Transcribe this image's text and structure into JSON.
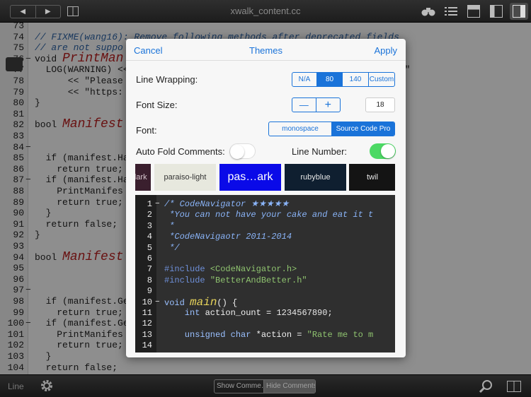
{
  "toolbar": {
    "back": "◀",
    "forward": "▶",
    "file_title": "xwalk_content.cc"
  },
  "editor": {
    "lines": [
      {
        "n": "73",
        "fold": "",
        "text": ""
      },
      {
        "n": "74",
        "fold": "",
        "text": "// FIXME(wang16): Remove following methods after deprecated fields",
        "cls": "cm"
      },
      {
        "n": "75",
        "fold": "",
        "text": "// are not suppo",
        "cls": "cm"
      },
      {
        "n": "76",
        "fold": "−",
        "pre": "void ",
        "fn": "PrintMan",
        "post": "                                          eld) {"
      },
      {
        "n": "77",
        "fold": "",
        "text": "  LOG(WARNING) <<                                                . \""
      },
      {
        "n": "78",
        "fold": "",
        "text": "      << \"Please"
      },
      {
        "n": "79",
        "fold": "",
        "text": "      << \"https:                                               t.\";"
      },
      {
        "n": "80",
        "fold": "",
        "text": "}"
      },
      {
        "n": "81",
        "fold": "",
        "text": ""
      },
      {
        "n": "82",
        "fold": "",
        "pre": "bool ",
        "fn": "Manifest",
        "post": "                                        nifest,"
      },
      {
        "n": "83",
        "fold": "",
        "text": ""
      },
      {
        "n": "84",
        "fold": "−",
        "text": ""
      },
      {
        "n": "85",
        "fold": "",
        "text": "  if (manifest.Ha"
      },
      {
        "n": "86",
        "fold": "",
        "text": "    return true;"
      },
      {
        "n": "87",
        "fold": "−",
        "text": "  if (manifest.Ha"
      },
      {
        "n": "88",
        "fold": "",
        "text": "    PrintManifes"
      },
      {
        "n": "89",
        "fold": "",
        "text": "    return true;"
      },
      {
        "n": "90",
        "fold": "",
        "text": "  }"
      },
      {
        "n": "91",
        "fold": "",
        "text": "  return false;"
      },
      {
        "n": "92",
        "fold": "",
        "text": "}"
      },
      {
        "n": "93",
        "fold": "",
        "text": ""
      },
      {
        "n": "94",
        "fold": "",
        "pre": "bool ",
        "fn": "Manifest",
        "post": "                                         manifest,"
      },
      {
        "n": "95",
        "fold": "",
        "text": ""
      },
      {
        "n": "96",
        "fold": "",
        "text": ""
      },
      {
        "n": "97",
        "fold": "−",
        "text": ""
      },
      {
        "n": "98",
        "fold": "",
        "text": "  if (manifest.Ge"
      },
      {
        "n": "99",
        "fold": "",
        "text": "    return true;"
      },
      {
        "n": "100",
        "fold": "−",
        "text": "  if (manifest.Ge"
      },
      {
        "n": "101",
        "fold": "",
        "text": "    PrintManifes"
      },
      {
        "n": "102",
        "fold": "",
        "text": "    return true;"
      },
      {
        "n": "103",
        "fold": "",
        "text": "  }"
      },
      {
        "n": "104",
        "fold": "",
        "text": "  return false;"
      }
    ]
  },
  "modal": {
    "cancel": "Cancel",
    "title": "Themes",
    "apply": "Apply",
    "line_wrapping": {
      "label": "Line Wrapping:",
      "options": [
        "N/A",
        "80",
        "140",
        "Custom"
      ],
      "selected": "80"
    },
    "font_size": {
      "label": "Font Size:",
      "minus": "—",
      "plus": "+",
      "value": "18"
    },
    "font": {
      "label": "Font:",
      "options": [
        "monospace",
        "Source Code Pro"
      ],
      "selected": "Source Code Pro"
    },
    "auto_fold": {
      "label": "Auto Fold Comments:",
      "on": false
    },
    "line_number": {
      "label": "Line Number:",
      "on": true
    },
    "themes": [
      {
        "name": "o-dark",
        "bg": "#3a1f2e",
        "fg": "#d8c8d0"
      },
      {
        "name": "paraiso-light",
        "bg": "#e7e8de",
        "fg": "#333333"
      },
      {
        "name": "pas…ark",
        "bg": "#0a0ae8",
        "fg": "#ffffff",
        "selected": true
      },
      {
        "name": "rubyblue",
        "bg": "#0f1f30",
        "fg": "#e6e6e6"
      },
      {
        "name": "twil",
        "bg": "#141414",
        "fg": "#e6e6e6"
      }
    ],
    "preview_lines": [
      {
        "n": "1",
        "fold": "−",
        "parts": [
          {
            "c": "p-cm",
            "t": "/* CodeNavigator ★★★★★"
          }
        ]
      },
      {
        "n": "2",
        "fold": "",
        "parts": [
          {
            "c": "p-cm",
            "t": " *You can not have your cake and eat it t"
          }
        ]
      },
      {
        "n": "3",
        "fold": "",
        "parts": [
          {
            "c": "p-cm",
            "t": " *"
          }
        ]
      },
      {
        "n": "4",
        "fold": "",
        "parts": [
          {
            "c": "p-cm",
            "t": " *CodeNavigaotr 2011-2014"
          }
        ]
      },
      {
        "n": "5",
        "fold": "",
        "parts": [
          {
            "c": "p-cm",
            "t": " */"
          }
        ]
      },
      {
        "n": "6",
        "fold": "",
        "parts": []
      },
      {
        "n": "7",
        "fold": "",
        "parts": [
          {
            "c": "p-pre",
            "t": "#include "
          },
          {
            "c": "p-str",
            "t": "<CodeNavigator.h>"
          }
        ]
      },
      {
        "n": "8",
        "fold": "",
        "parts": [
          {
            "c": "p-pre",
            "t": "#include "
          },
          {
            "c": "p-str",
            "t": "\"BetterAndBetter.h\""
          }
        ]
      },
      {
        "n": "9",
        "fold": "",
        "parts": []
      },
      {
        "n": "10",
        "fold": "−",
        "parts": [
          {
            "c": "p-kw",
            "t": "void "
          },
          {
            "c": "p-fn",
            "t": "main"
          },
          {
            "c": "p-plain",
            "t": "() {"
          }
        ]
      },
      {
        "n": "11",
        "fold": "",
        "parts": [
          {
            "c": "p-kw",
            "t": "    int "
          },
          {
            "c": "p-plain",
            "t": "action_ount = "
          },
          {
            "c": "p-num",
            "t": "1234567890"
          },
          {
            "c": "p-plain",
            "t": ";"
          }
        ]
      },
      {
        "n": "12",
        "fold": "",
        "parts": []
      },
      {
        "n": "13",
        "fold": "",
        "parts": [
          {
            "c": "p-kw",
            "t": "    unsigned char "
          },
          {
            "c": "p-plain",
            "t": "*action = "
          },
          {
            "c": "p-str",
            "t": "\"Rate me to m"
          }
        ]
      },
      {
        "n": "14",
        "fold": "",
        "parts": []
      }
    ]
  },
  "bottombar": {
    "line_label": "Line",
    "show_comments": "Show Comme…",
    "hide_comments": "Hide Comments"
  }
}
